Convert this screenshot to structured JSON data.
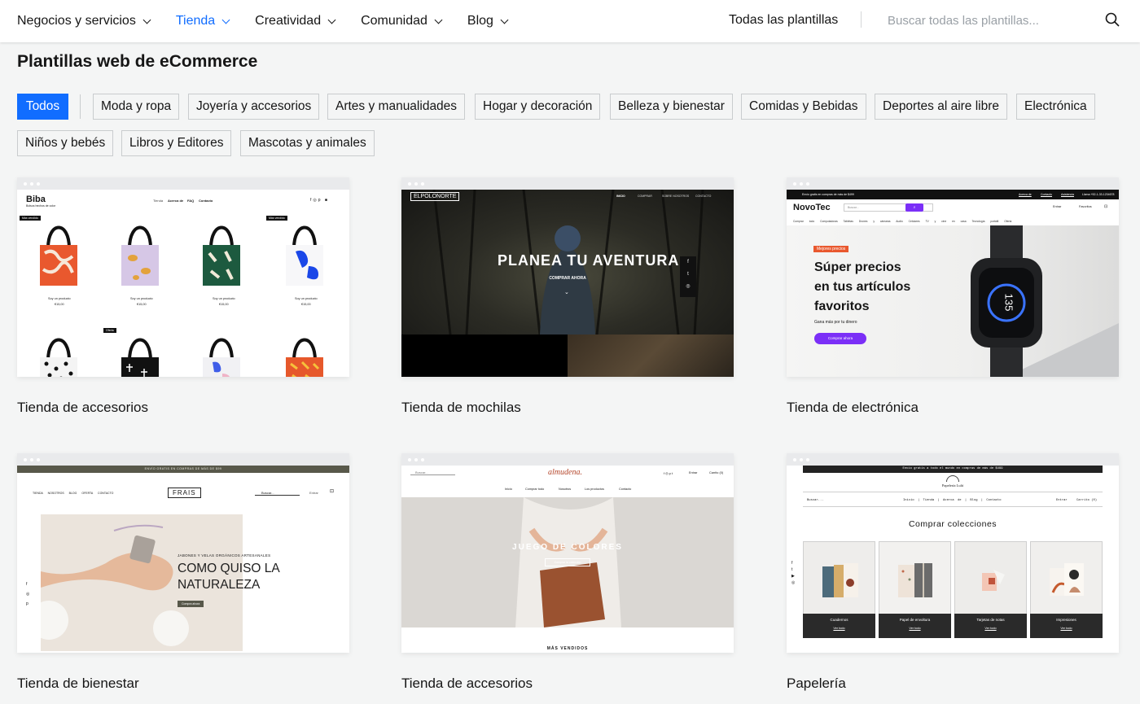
{
  "nav": {
    "items": [
      {
        "label": "Negocios y servicios",
        "active": false
      },
      {
        "label": "Tienda",
        "active": true
      },
      {
        "label": "Creatividad",
        "active": false
      },
      {
        "label": "Comunidad",
        "active": false
      },
      {
        "label": "Blog",
        "active": false
      }
    ],
    "all_templates": "Todas las plantillas",
    "search_placeholder": "Buscar todas las plantillas...",
    "accent_color": "#116dff"
  },
  "page_title": "Plantillas web de eCommerce",
  "filters": [
    {
      "label": "Todos",
      "active": true
    },
    {
      "label": "Moda y ropa"
    },
    {
      "label": "Joyería y accesorios"
    },
    {
      "label": "Artes y manualidades"
    },
    {
      "label": "Hogar y decoración"
    },
    {
      "label": "Belleza y bienestar"
    },
    {
      "label": "Comidas y Bebidas"
    },
    {
      "label": "Deportes al aire libre"
    },
    {
      "label": "Electrónica"
    },
    {
      "label": "Niños y bebés"
    },
    {
      "label": "Libros y Editores"
    },
    {
      "label": "Mascotas y animales"
    }
  ],
  "cards": [
    {
      "name": "Tienda de accesorios",
      "preview": {
        "brand": "Biba",
        "tagline": "Bolsos hechos de color",
        "menu": [
          "Tienda",
          "Acerca de",
          "FAQ",
          "Contacto"
        ],
        "badges": [
          "Más vendido",
          "Más vendido",
          "Oferta"
        ],
        "product_name": "Soy un producto",
        "price": "€15,00"
      }
    },
    {
      "name": "Tienda de mochilas",
      "preview": {
        "brand": "ELPOLONORTE",
        "menu": [
          "INICIO",
          "COMPRAR",
          "SOBRE NOSOTROS",
          "CONTACTO"
        ],
        "hero": "PLANEA TU AVENTURA",
        "cta": "COMPRAR AHORA"
      }
    },
    {
      "name": "Tienda de electrónica",
      "preview": {
        "promo": "Envío gratis en compras de más de $499",
        "toplinks": [
          "Acerca de",
          "Contacto",
          "Asistencia",
          "Llama +52-1-33-1234678"
        ],
        "brand": "NovoTec",
        "search": "Buscar...",
        "login": "Entrar",
        "favorites": "Favoritos",
        "menu": [
          "Comprar todo",
          "Computadoras",
          "Tabletas",
          "Drones y cámaras",
          "Audio",
          "Celulares",
          "TV y cine en casa",
          "Tecnología portátil",
          "Oferta"
        ],
        "tag": "Mejores precios",
        "hero_lines": [
          "Súper precios",
          "en tus artículos",
          "favoritos"
        ],
        "sub": "Gana más por tu dinero",
        "cta": "Comprar ahora",
        "watch": "135",
        "accent": "#7b2ff7"
      }
    },
    {
      "name": "Tienda de bienestar",
      "preview": {
        "promo": "ENVÍO GRATIS EN COMPRAS DE MÁS DE $99",
        "menu": [
          "TIENDA",
          "NOSOTROS",
          "BLOG",
          "OFERTA",
          "CONTACTO"
        ],
        "brand": "FRAIS",
        "search": "Buscar...",
        "login": "Entrar",
        "kicker": "JABONES Y VELAS ORGÁNICOS ARTESANALES",
        "hero_lines": [
          "COMO QUISO LA",
          "NATURALEZA"
        ],
        "cta": "Compra ahora"
      }
    },
    {
      "name": "Tienda de accesorios",
      "preview": {
        "search": "Buscar...",
        "brand": "almudena.",
        "login": "Entrar",
        "cart": "Carrito (0)",
        "menu": [
          "Inicio",
          "Comprar todo",
          "Nosotros",
          "Los productos",
          "Contacto"
        ],
        "hero": "JUEGO DE COLORES",
        "cta": "Comprar la colección",
        "section": "MÁS VENDIDOS"
      }
    },
    {
      "name": "Papelería",
      "preview": {
        "promo": "Envío gratis a todo el mundo en compras de más de $499",
        "brand": "Papelería Lulú",
        "search": "Buscar...",
        "menu": [
          "Inicio",
          "Tienda",
          "Acerca de",
          "Blog",
          "Contacto"
        ],
        "login": "Entrar",
        "cart": "Carrito (0)",
        "heading": "Comprar colecciones",
        "collections": [
          "Cuadernos",
          "Papel de envoltura",
          "Tarjetas de notas",
          "Impresiones"
        ],
        "see_all": "Ver todo"
      }
    }
  ]
}
